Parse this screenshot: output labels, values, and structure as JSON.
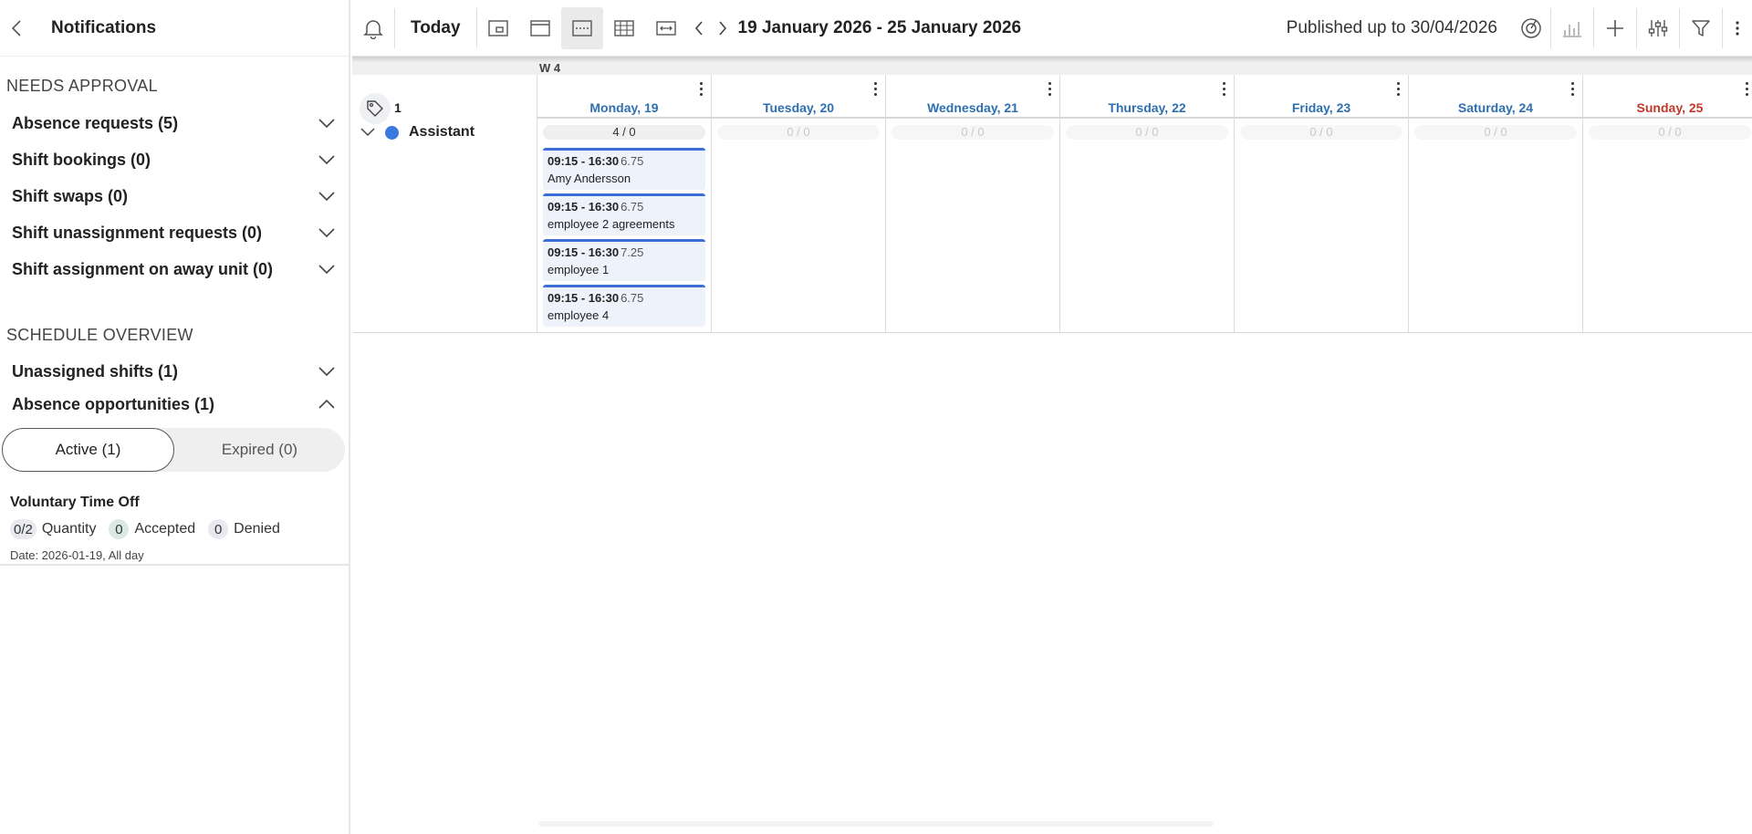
{
  "sidebar": {
    "title": "Notifications",
    "needs_approval_heading": "NEEDS APPROVAL",
    "needs_approval": [
      {
        "label": "Absence requests (5)"
      },
      {
        "label": "Shift bookings (0)"
      },
      {
        "label": "Shift swaps (0)"
      },
      {
        "label": "Shift unassignment requests (0)"
      },
      {
        "label": "Shift assignment on away unit (0)"
      }
    ],
    "overview_heading": "SCHEDULE OVERVIEW",
    "overview": [
      {
        "label": "Unassigned shifts (1)"
      },
      {
        "label": "Absence opportunities (1)"
      }
    ],
    "tabs": {
      "active": "Active (1)",
      "expired": "Expired (0)"
    },
    "opportunity": {
      "title": "Voluntary Time Off",
      "quantity_value": "0/2",
      "quantity_label": "Quantity",
      "accepted_value": "0",
      "accepted_label": "Accepted",
      "denied_value": "0",
      "denied_label": "Denied",
      "date": "Date: 2026-01-19, All day"
    }
  },
  "toolbar": {
    "today": "Today",
    "date_range": "19 January 2026 - 25 January 2026",
    "published": "Published up to 30/04/2026"
  },
  "calendar": {
    "week": "W 4",
    "tag_count": "1",
    "group": "Assistant",
    "group_color": "#3b79e0",
    "days": [
      {
        "label": "Monday, 19",
        "cover": "4 / 0"
      },
      {
        "label": "Tuesday, 20",
        "cover": "0 / 0"
      },
      {
        "label": "Wednesday, 21",
        "cover": "0 / 0"
      },
      {
        "label": "Thursday, 22",
        "cover": "0 / 0"
      },
      {
        "label": "Friday, 23",
        "cover": "0 / 0"
      },
      {
        "label": "Saturday, 24",
        "cover": "0 / 0"
      },
      {
        "label": "Sunday, 25",
        "cover": "0 / 0"
      }
    ],
    "shifts": [
      {
        "time": "09:15 - 16:30",
        "hours": "6.75",
        "employee": "Amy Andersson"
      },
      {
        "time": "09:15 - 16:30",
        "hours": "6.75",
        "employee": "employee 2 agreements"
      },
      {
        "time": "09:15 - 16:30",
        "hours": "7.25",
        "employee": "employee 1"
      },
      {
        "time": "09:15 - 16:30",
        "hours": "6.75",
        "employee": "employee 4"
      }
    ]
  },
  "colors": {
    "accent_blue": "#3b6fd6",
    "day_label_blue": "#2e6fb0",
    "sunday_red": "#c0392b"
  }
}
